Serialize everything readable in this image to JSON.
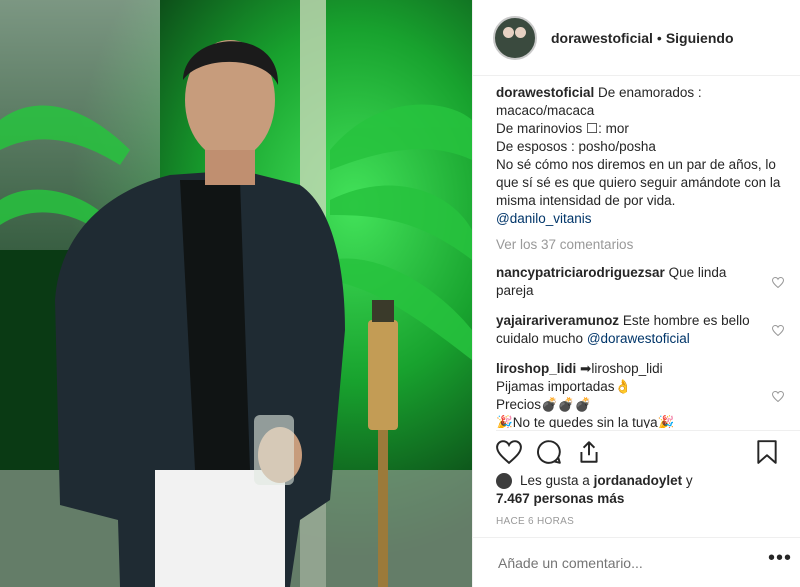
{
  "header": {
    "username": "dorawestoficial",
    "separator": "•",
    "follow_status": "Siguiendo"
  },
  "caption": {
    "username": "dorawestoficial",
    "text": " De enamorados : macaco/macaca\nDe marinovios ☐: mor\nDe esposos : posho/posha\nNo sé cómo nos diremos en un par de años, lo que sí sé es que quiero seguir amándote con la misma intensidad de por vida.\n",
    "mention": "@danilo_vitanis"
  },
  "view_all_comments": "Ver los 37 comentarios",
  "comments": [
    {
      "username": "nancypatriciarodriguezsar",
      "text": " Que linda pareja",
      "mention": ""
    },
    {
      "username": "yajairariveramunoz",
      "text": " Este hombre es bello cuidalo mucho ",
      "mention": "@dorawestoficial"
    },
    {
      "username": "liroshop_lidi",
      "text": " ➡liroshop_lidi\nPijamas importadas👌\nPrecios💣💣💣\n🎉No te quedes sin la tuya🎉",
      "mention": ""
    }
  ],
  "actions": {
    "like_icon": "heart-icon",
    "comment_icon": "comment-icon",
    "share_icon": "share-icon",
    "save_icon": "bookmark-icon"
  },
  "likes": {
    "prefix": "Les gusta a ",
    "user": "jordanadoylet",
    "middle": " y ",
    "count": "7.467 personas más"
  },
  "timestamp": "HACE 6 HORAS",
  "add_comment": {
    "placeholder": "Añade un comentario...",
    "more_label": "•••"
  },
  "colors": {
    "link": "#003569",
    "muted": "#999999",
    "border": "#efefef",
    "photo_green": "#2ecc40"
  }
}
